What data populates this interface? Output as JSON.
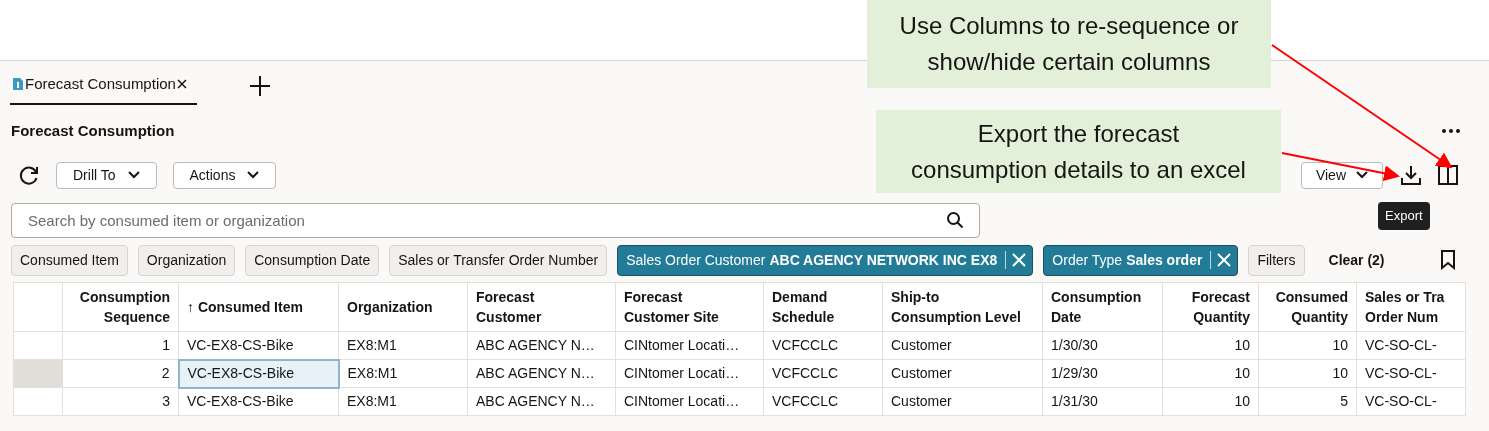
{
  "callouts": [
    {
      "lines": [
        "Use Columns to re-sequence or",
        "show/hide certain columns"
      ]
    },
    {
      "lines": [
        "Export the forecast",
        "consumption details to an excel"
      ]
    }
  ],
  "tabs": [
    {
      "label": "Forecast Consumption",
      "selected": true
    }
  ],
  "page_title": "Forecast Consumption",
  "toolbar": {
    "buttons": [
      "Drill To",
      "Actions"
    ],
    "view_button": "View",
    "tooltip": "Export"
  },
  "search": {
    "placeholder": "Search by consumed item or organization"
  },
  "filters": [
    {
      "kind": "plain",
      "label": "Consumed Item"
    },
    {
      "kind": "plain",
      "label": "Organization"
    },
    {
      "kind": "plain",
      "label": "Consumption Date"
    },
    {
      "kind": "plain",
      "label": "Sales or Transfer Order Number"
    },
    {
      "kind": "applied",
      "label": "Sales Order Customer",
      "value": "ABC AGENCY NETWORK INC EX8"
    },
    {
      "kind": "applied",
      "label": "Order Type",
      "value": "Sales order"
    },
    {
      "kind": "button",
      "label": "Filters"
    },
    {
      "kind": "link",
      "label": "Clear (2)"
    }
  ],
  "table": {
    "columns": [
      {
        "lines": [
          "Consumption",
          "Sequence"
        ],
        "kind": "number"
      },
      {
        "lines": [
          "↑ Consumed Item"
        ],
        "kind": "text"
      },
      {
        "lines": [
          "Organization"
        ],
        "kind": "text"
      },
      {
        "lines": [
          "Forecast",
          "Customer"
        ],
        "kind": "text"
      },
      {
        "lines": [
          "Forecast",
          "Customer Site"
        ],
        "kind": "text"
      },
      {
        "lines": [
          "Demand",
          "Schedule"
        ],
        "kind": "text"
      },
      {
        "lines": [
          "Ship-to",
          "Consumption Level"
        ],
        "kind": "text"
      },
      {
        "lines": [
          "Consumption",
          "Date"
        ],
        "kind": "text"
      },
      {
        "lines": [
          "Forecast",
          "Quantity"
        ],
        "kind": "number"
      },
      {
        "lines": [
          "Consumed",
          "Quantity"
        ],
        "kind": "number"
      },
      {
        "lines": [
          "Sales or Tra",
          "Order Num"
        ],
        "kind": "text"
      }
    ],
    "rows": [
      {
        "selected": false,
        "cells": [
          "1",
          "VC-EX8-CS-Bike",
          "EX8:M1",
          "ABC AGENCY N…",
          "CINtomer Locati…",
          "VCFCCLC",
          "Customer",
          "1/30/30",
          "10",
          "10",
          "VC-SO-CL-"
        ]
      },
      {
        "selected": true,
        "cells": [
          "2",
          "VC-EX8-CS-Bike",
          "EX8:M1",
          "ABC AGENCY N…",
          "CINtomer Locati…",
          "VCFCCLC",
          "Customer",
          "1/29/30",
          "10",
          "10",
          "VC-SO-CL-"
        ]
      },
      {
        "selected": false,
        "cells": [
          "3",
          "VC-EX8-CS-Bike",
          "EX8:M1",
          "ABC AGENCY N…",
          "CINtomer Locati…",
          "VCFCCLC",
          "Customer",
          "1/31/30",
          "10",
          "5",
          "VC-SO-CL-"
        ]
      }
    ]
  }
}
